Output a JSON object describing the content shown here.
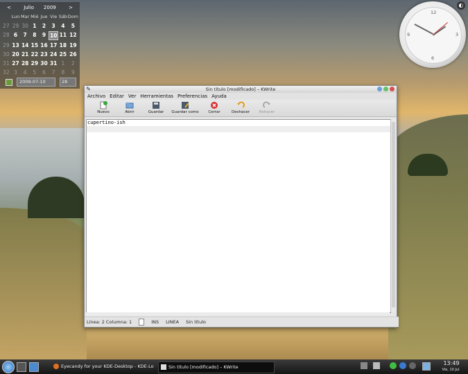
{
  "calendar": {
    "prev": "<",
    "month": "Julio",
    "year": "2009",
    "next": ">",
    "headers": [
      "Lun",
      "Mar",
      "Mié",
      "Jue",
      "Vie",
      "Sáb",
      "Dom"
    ],
    "weeks": [
      {
        "wk": "27",
        "days": [
          "29",
          "30",
          "1",
          "2",
          "3",
          "4",
          "5"
        ]
      },
      {
        "wk": "28",
        "days": [
          "6",
          "7",
          "8",
          "9",
          "10",
          "11",
          "12"
        ]
      },
      {
        "wk": "29",
        "days": [
          "13",
          "14",
          "15",
          "16",
          "17",
          "18",
          "19"
        ]
      },
      {
        "wk": "30",
        "days": [
          "20",
          "21",
          "22",
          "23",
          "24",
          "25",
          "26"
        ]
      },
      {
        "wk": "31",
        "days": [
          "27",
          "28",
          "29",
          "30",
          "31",
          "1",
          "2"
        ]
      },
      {
        "wk": "32",
        "days": [
          "3",
          "4",
          "5",
          "6",
          "7",
          "8",
          "9"
        ]
      }
    ],
    "date_value": "2009-07-10",
    "week_value": "28"
  },
  "clock_numbers": {
    "twelve": "12",
    "three": "3",
    "six": "6",
    "nine": "9"
  },
  "clock_corner": "◐",
  "window": {
    "title": "Sin título [modificado] – KWrite",
    "menu": [
      "Archivo",
      "Editar",
      "Ver",
      "Herramientas",
      "Preferencias",
      "Ayuda"
    ],
    "toolbar": {
      "new": "Nuevo",
      "open": "Abrir",
      "save": "Guardar",
      "save_as": "Guardar como",
      "close": "Cerrar",
      "undo": "Deshacer",
      "redo": "Rehacer"
    },
    "text": "cupertino-ish",
    "status": {
      "line": "Línea: 2",
      "column": "Columna: 1",
      "ins": "INS",
      "mode": "LINEA",
      "file": "Sin título"
    }
  },
  "taskbar": {
    "task1": "Eyecandy for your KDE-Desktop - KDE-Lo",
    "task2": "Sin título [modificado] – KWrite",
    "time": "13:49",
    "date": "Vie, 10 Jul"
  }
}
